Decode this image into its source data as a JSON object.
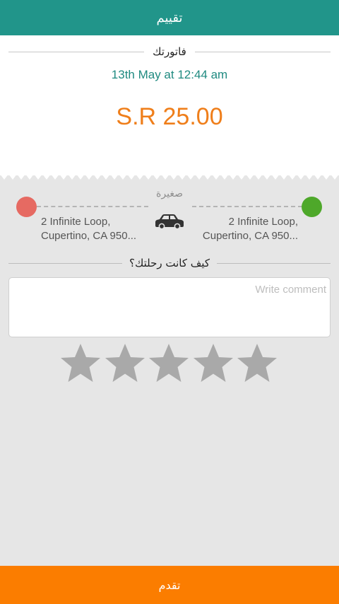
{
  "header": {
    "title": "تقييم"
  },
  "invoice": {
    "label": "فاتورتك",
    "date": "13th May at 12:44 am",
    "amount": "S.R 25.00"
  },
  "trip": {
    "car_type": "صغيرة",
    "pickup": {
      "line1": "2 Infinite Loop,",
      "line2": "Cupertino, CA 950..."
    },
    "dropoff": {
      "line1": "2 Infinite Loop,",
      "line2": "Cupertino, CA 950..."
    },
    "pickup_pin_color": "#e66a62",
    "dropoff_pin_color": "#4ea82a",
    "car_icon": "car-icon"
  },
  "feedback": {
    "question": "كيف كانت رحلتك؟",
    "comment_placeholder": "Write comment",
    "comment_value": "",
    "rating": 0,
    "max_rating": 5
  },
  "footer": {
    "submit_label": "تقدم"
  },
  "colors": {
    "header": "#21958a",
    "accent_orange": "#fb7d00",
    "amount": "#ef7e1a",
    "star_empty": "#a9a9a9"
  }
}
